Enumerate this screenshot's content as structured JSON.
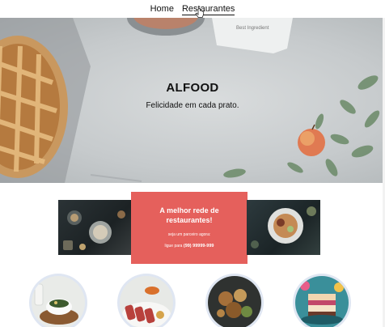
{
  "nav": {
    "links": [
      {
        "label": "Home"
      },
      {
        "label": "Restaurantes"
      }
    ]
  },
  "hero": {
    "title": "ALFOOD",
    "subtitle": "Felicidade em cada prato.",
    "paper_text": "Best Ingredient"
  },
  "promo": {
    "title_line1": "A melhor rede de",
    "title_line2": "restaurantes!",
    "text": "seja um parceiro agora:",
    "phone_prefix": "ligue para",
    "phone": "(99) 99999-999"
  },
  "categories": [
    {
      "icon": "salad-bowl-image"
    },
    {
      "icon": "sliced-steak-image"
    },
    {
      "icon": "roasted-vegetables-image"
    },
    {
      "icon": "layered-cake-image"
    }
  ],
  "colors": {
    "promo_card": "#e5605c",
    "hero_bg": "#c6cacc",
    "circle_ring": "#dfe6f2"
  }
}
